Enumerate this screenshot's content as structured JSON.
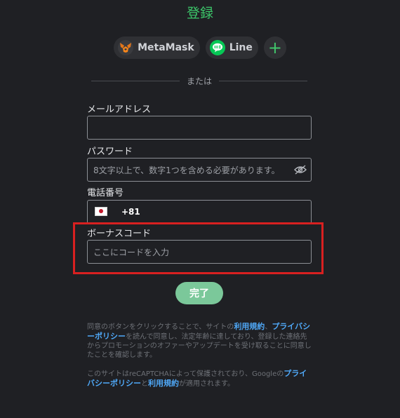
{
  "page": {
    "title": "登録"
  },
  "social": {
    "metamask_label": "MetaMask",
    "line_label": "Line",
    "add_symbol": "+"
  },
  "divider_text": "または",
  "form": {
    "email": {
      "label": "メールアドレス",
      "placeholder": "",
      "value": ""
    },
    "password": {
      "label": "パスワード",
      "placeholder": "8文字以上で、数字1つを含める必要があります。"
    },
    "phone": {
      "label": "電話番号",
      "country_code": "+81",
      "flag": "japan-flag"
    },
    "bonus": {
      "label": "ボーナスコード",
      "placeholder": "ここにコードを入力"
    }
  },
  "submit_label": "完了",
  "legal": {
    "p1_pre": "同意のボタンをクリックすることで、サイトの",
    "p1_link1": "利用規約",
    "p1_sep": "、",
    "p1_link2": "プライバシーポリシー",
    "p1_post": "を読んで同意し、法定年齢に達しており、登録した連絡先からプロモーションのオファーやアップデートを受け取ることに同意したことを確認します。",
    "p2_pre": "このサイトはreCAPTCHAによって保護されており、Googleの",
    "p2_link1": "プライバシーポリシー",
    "p2_sep": "と",
    "p2_link2": "利用規約",
    "p2_post": "が適用されます。"
  },
  "colors": {
    "accent_green": "#3cc76a",
    "button_green": "#7bc89a",
    "highlight_red": "#d82020",
    "link_blue": "#4fa8f7"
  }
}
